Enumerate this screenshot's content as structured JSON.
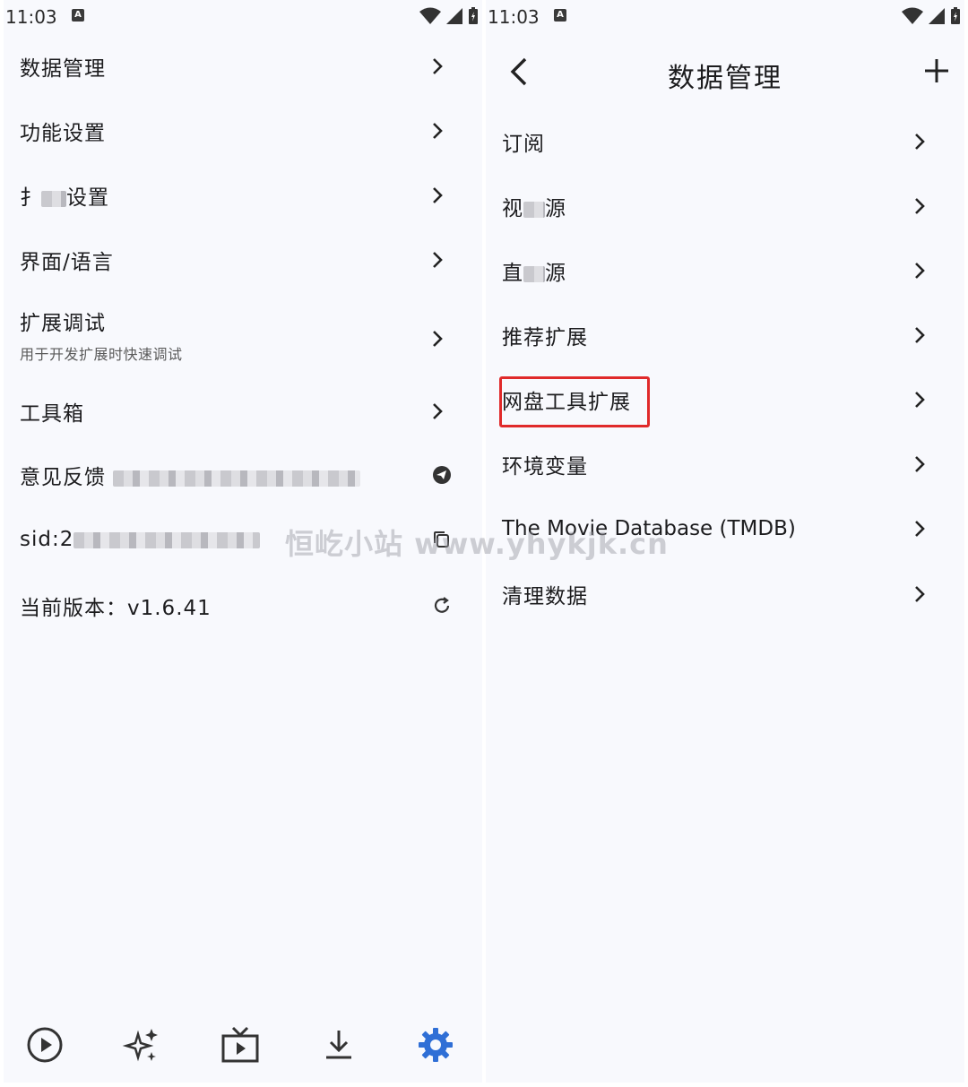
{
  "status_bar": {
    "time": "11:03",
    "notification_icon": "A"
  },
  "left_panel": {
    "menu": [
      {
        "label": "数据管理",
        "trailing": "chevron"
      },
      {
        "label": "功能设置",
        "trailing": "chevron"
      },
      {
        "label_prefix": "扌",
        "label_suffix": "设置",
        "trailing": "chevron",
        "redacted": true
      },
      {
        "label": "界面/语言",
        "trailing": "chevron"
      },
      {
        "label": "扩展调试",
        "subtitle": "用于开发扩展时快速调试",
        "trailing": "chevron"
      },
      {
        "label": "工具箱",
        "trailing": "chevron"
      },
      {
        "label": "意见反馈",
        "trailing": "telegram-icon",
        "redacted": true
      },
      {
        "label": "sid:2",
        "trailing": "copy-icon",
        "redacted": true
      },
      {
        "label": "当前版本：v1.6.41",
        "trailing": "refresh-icon"
      }
    ],
    "bottom_nav": [
      {
        "icon": "play-circle-icon",
        "active": false
      },
      {
        "icon": "sparkles-icon",
        "active": false
      },
      {
        "icon": "tv-icon",
        "active": false
      },
      {
        "icon": "download-icon",
        "active": false
      },
      {
        "icon": "gear-icon",
        "active": true
      }
    ]
  },
  "right_panel": {
    "title": "数据管理",
    "items": [
      {
        "label": "订阅"
      },
      {
        "label_prefix": "视",
        "label_suffix": "源",
        "redacted": true
      },
      {
        "label_prefix": "直",
        "label_suffix": "源",
        "redacted": true
      },
      {
        "label": "推荐扩展"
      },
      {
        "label": "网盘工具扩展",
        "highlighted": true
      },
      {
        "label": "环境变量"
      },
      {
        "label": "The Movie Database (TMDB)"
      },
      {
        "label": "清理数据"
      }
    ]
  },
  "watermark": "恒屹小站 www.yhykjk.cn",
  "colors": {
    "accent": "#2f6fd6",
    "highlight_border": "#e02a2a",
    "background": "#f8f9fd",
    "text": "#1c1c1e"
  }
}
